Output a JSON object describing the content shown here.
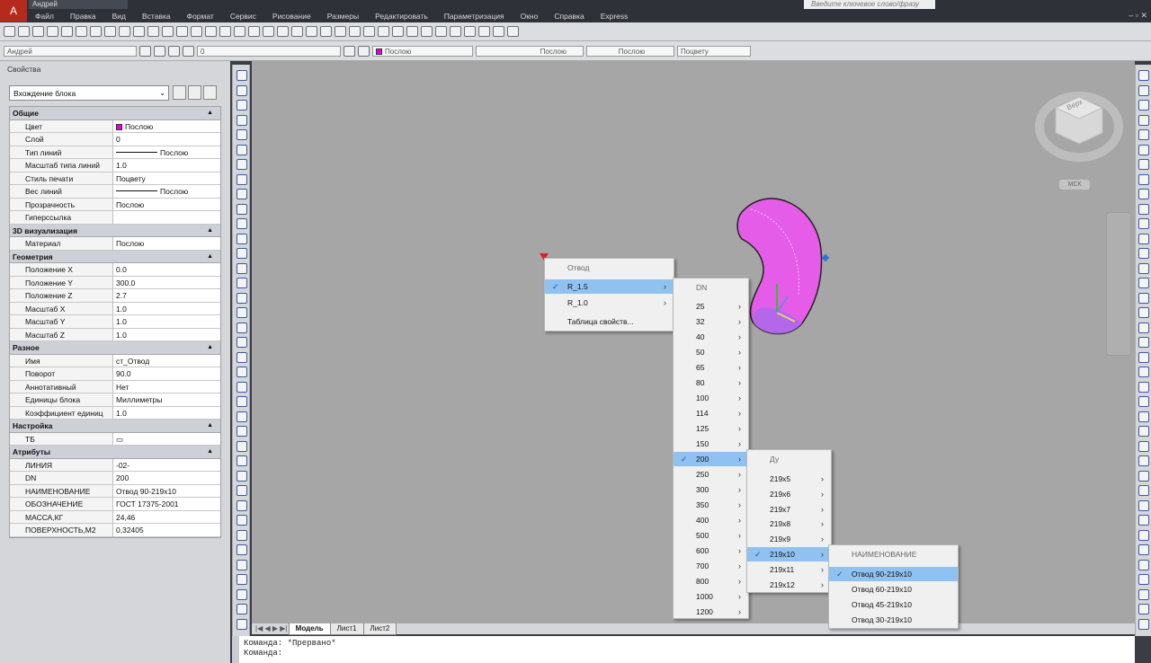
{
  "titlebar": {
    "user": "Андрей",
    "search_placeholder": "Введите ключевое слово/фразу"
  },
  "menubar": {
    "items": [
      "Файл",
      "Правка",
      "Вид",
      "Вставка",
      "Формат",
      "Сервис",
      "Рисование",
      "Размеры",
      "Редактировать",
      "Параметризация",
      "Окно",
      "Справка",
      "Express"
    ]
  },
  "toolbar3": {
    "layer_user": "Андрей",
    "layer_zero": "0",
    "color": "Послою",
    "linetype": "Послою",
    "lineweight": "Послою",
    "plotstyle": "Поцвету"
  },
  "properties": {
    "title": "Свойства",
    "block_select": "Вхождение блока",
    "categories": [
      {
        "name": "Общие",
        "rows": [
          {
            "k": "Цвет",
            "v": "Послою"
          },
          {
            "k": "Слой",
            "v": "0"
          },
          {
            "k": "Тип линий",
            "v": "Послою"
          },
          {
            "k": "Масштаб типа линий",
            "v": "1.0"
          },
          {
            "k": "Стиль печати",
            "v": "Поцвету"
          },
          {
            "k": "Вес линий",
            "v": "Послою"
          },
          {
            "k": "Прозрачность",
            "v": "Послою"
          },
          {
            "k": "Гиперссылка",
            "v": ""
          }
        ]
      },
      {
        "name": "3D визуализация",
        "rows": [
          {
            "k": "Материал",
            "v": "Послою"
          }
        ]
      },
      {
        "name": "Геометрия",
        "rows": [
          {
            "k": "Положение X",
            "v": "0.0"
          },
          {
            "k": "Положение Y",
            "v": "300.0"
          },
          {
            "k": "Положение Z",
            "v": "2.7"
          },
          {
            "k": "Масштаб X",
            "v": "1.0"
          },
          {
            "k": "Масштаб Y",
            "v": "1.0"
          },
          {
            "k": "Масштаб Z",
            "v": "1.0"
          }
        ]
      },
      {
        "name": "Разное",
        "rows": [
          {
            "k": "Имя",
            "v": "ст_Отвод"
          },
          {
            "k": "Поворот",
            "v": "90.0"
          },
          {
            "k": "Аннотативный",
            "v": "Нет"
          },
          {
            "k": "Единицы блока",
            "v": "Миллиметры"
          },
          {
            "k": "Коэффициент единиц",
            "v": "1.0"
          }
        ]
      },
      {
        "name": "Настройка",
        "rows": [
          {
            "k": "ТБ",
            "v": ""
          }
        ]
      },
      {
        "name": "Атрибуты",
        "rows": [
          {
            "k": "ЛИНИЯ",
            "v": "-02-"
          },
          {
            "k": "DN",
            "v": "200"
          },
          {
            "k": "НАИМЕНОВАНИЕ",
            "v": "Отвод 90-219х10"
          },
          {
            "k": "ОБОЗНАЧЕНИЕ",
            "v": "ГОСТ 17375-2001"
          },
          {
            "k": "МАССА,КГ",
            "v": "24,46"
          },
          {
            "k": "ПОВЕРХНОСТЬ,М2",
            "v": "0,32405"
          }
        ]
      }
    ]
  },
  "menu1": {
    "header": "Отвод",
    "items": [
      {
        "label": "R_1.5",
        "checked": true,
        "sub": true
      },
      {
        "label": "R_1.0",
        "sub": true
      },
      {
        "label": "Таблица свойств...",
        "sub": false
      }
    ]
  },
  "menu2": {
    "header": "DN",
    "items": [
      "25",
      "32",
      "40",
      "50",
      "65",
      "80",
      "100",
      "114",
      "125",
      "150",
      "200",
      "250",
      "300",
      "350",
      "400",
      "500",
      "600",
      "700",
      "800",
      "1000",
      "1200"
    ],
    "selected": "200"
  },
  "menu3": {
    "header": "Ду",
    "items": [
      "219х5",
      "219х6",
      "219х7",
      "219х8",
      "219х9",
      "219х10",
      "219х11",
      "219х12"
    ],
    "selected": "219х10"
  },
  "menu4": {
    "header": "НАИМЕНОВАНИЕ",
    "items": [
      "Отвод 90-219х10",
      "Отвод 60-219х10",
      "Отвод 45-219х10",
      "Отвод 30-219х10"
    ],
    "selected": "Отвод 90-219х10"
  },
  "viewcube": {
    "top_label": "Верх",
    "ucs": "МСК"
  },
  "tabs": [
    "Модель",
    "Лист1",
    "Лист2"
  ],
  "command": {
    "line1": "Команда: *Прервано*",
    "line2": "Команда:"
  },
  "colors": {
    "accent": "#e000e0",
    "highlight": "#8fc2f0",
    "app_red": "#b52a1d"
  }
}
